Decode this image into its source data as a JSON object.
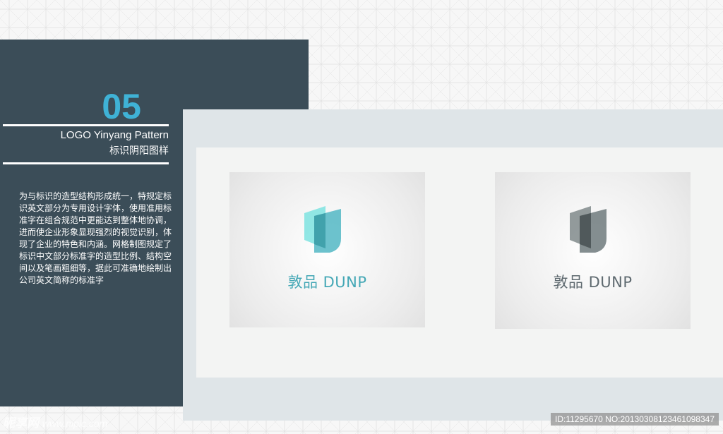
{
  "section": {
    "number": "05",
    "title_en": "LOGO Yinyang Pattern",
    "title_cn": "标识阴阳图样",
    "description": "为与标识的造型结构形成统一，特规定标识英文部分为专用设计字体，使用准用标准字在组合规范中更能达到整体地协调，进而使企业形象显现强烈的视觉识别，体现了企业的特色和内涵。网格制图规定了标识中文部分标准字的造型比例、结构空间以及笔画粗细等，据此可准确地绘制出公司英文简称的标准字"
  },
  "logos": [
    {
      "brand": "敦品 DUNP",
      "variant": "color",
      "accent": "#45a8b6",
      "front": "#52b7c4",
      "back": "#7ee3e0"
    },
    {
      "brand": "敦品 DUNP",
      "variant": "gray",
      "accent": "#5f6a70",
      "front": "#6f7a7c",
      "back": "#808a8b"
    }
  ],
  "watermark": {
    "logo": "昵享网",
    "url": "www.nipic.com"
  },
  "image_id": "ID:11295670 NO:20130308123461098347"
}
